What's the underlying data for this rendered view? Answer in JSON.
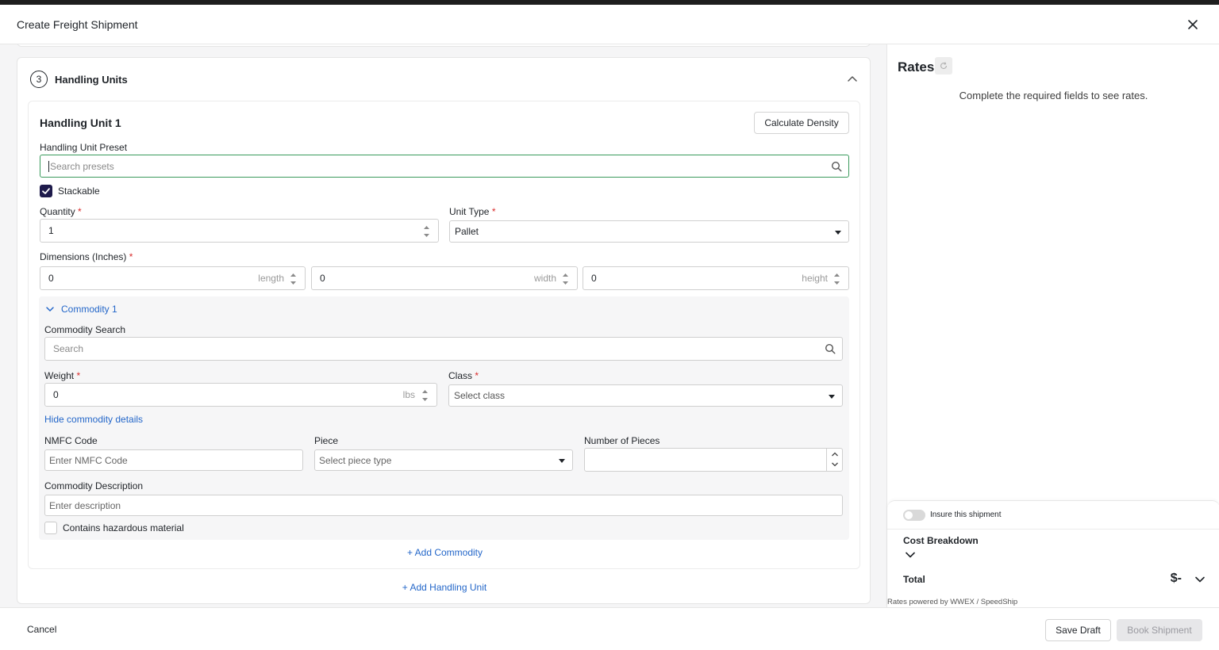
{
  "modal": {
    "title": "Create Freight Shipment"
  },
  "section": {
    "step": "3",
    "title": "Handling Units"
  },
  "handling_unit": {
    "title": "Handling Unit 1",
    "calculate_density": "Calculate Density",
    "preset_label": "Handling Unit Preset",
    "preset_placeholder": "Search presets",
    "stackable_label": "Stackable",
    "stackable_checked": true,
    "quantity_label": "Quantity",
    "quantity_value": "1",
    "unit_type_label": "Unit Type",
    "unit_type_value": "Pallet",
    "dimensions_label": "Dimensions (Inches)",
    "length_value": "0",
    "length_suffix": "length",
    "width_value": "0",
    "width_suffix": "width",
    "height_value": "0",
    "height_suffix": "height",
    "required_mark": "*"
  },
  "commodity": {
    "title": "Commodity 1",
    "search_label": "Commodity Search",
    "search_placeholder": "Search",
    "weight_label": "Weight",
    "weight_value": "0",
    "weight_suffix": "lbs",
    "class_label": "Class",
    "class_placeholder": "Select class",
    "hide_details": "Hide commodity details",
    "nmfc_label": "NMFC Code",
    "nmfc_placeholder": "Enter NMFC Code",
    "piece_label": "Piece",
    "piece_placeholder": "Select piece type",
    "pieces_label": "Number of Pieces",
    "description_label": "Commodity Description",
    "description_placeholder": "Enter description",
    "hazardous_label": "Contains hazardous material",
    "add_commodity": "+ Add Commodity"
  },
  "add_handling_unit": "+ Add Handling Unit",
  "rates": {
    "title": "Rates",
    "message": "Complete the required fields to see rates.",
    "insure_label": "Insure this shipment",
    "cost_breakdown": "Cost Breakdown",
    "total_label": "Total",
    "total_value": "$-",
    "powered_by": "Rates powered by WWEX / SpeedShip"
  },
  "footer": {
    "cancel": "Cancel",
    "save_draft": "Save Draft",
    "book_shipment": "Book Shipment"
  },
  "colors": {
    "accent_link": "#2467c9",
    "checkbox": "#1e1b4b",
    "focus_border": "#3a9a5c",
    "required": "#d92c2c"
  }
}
